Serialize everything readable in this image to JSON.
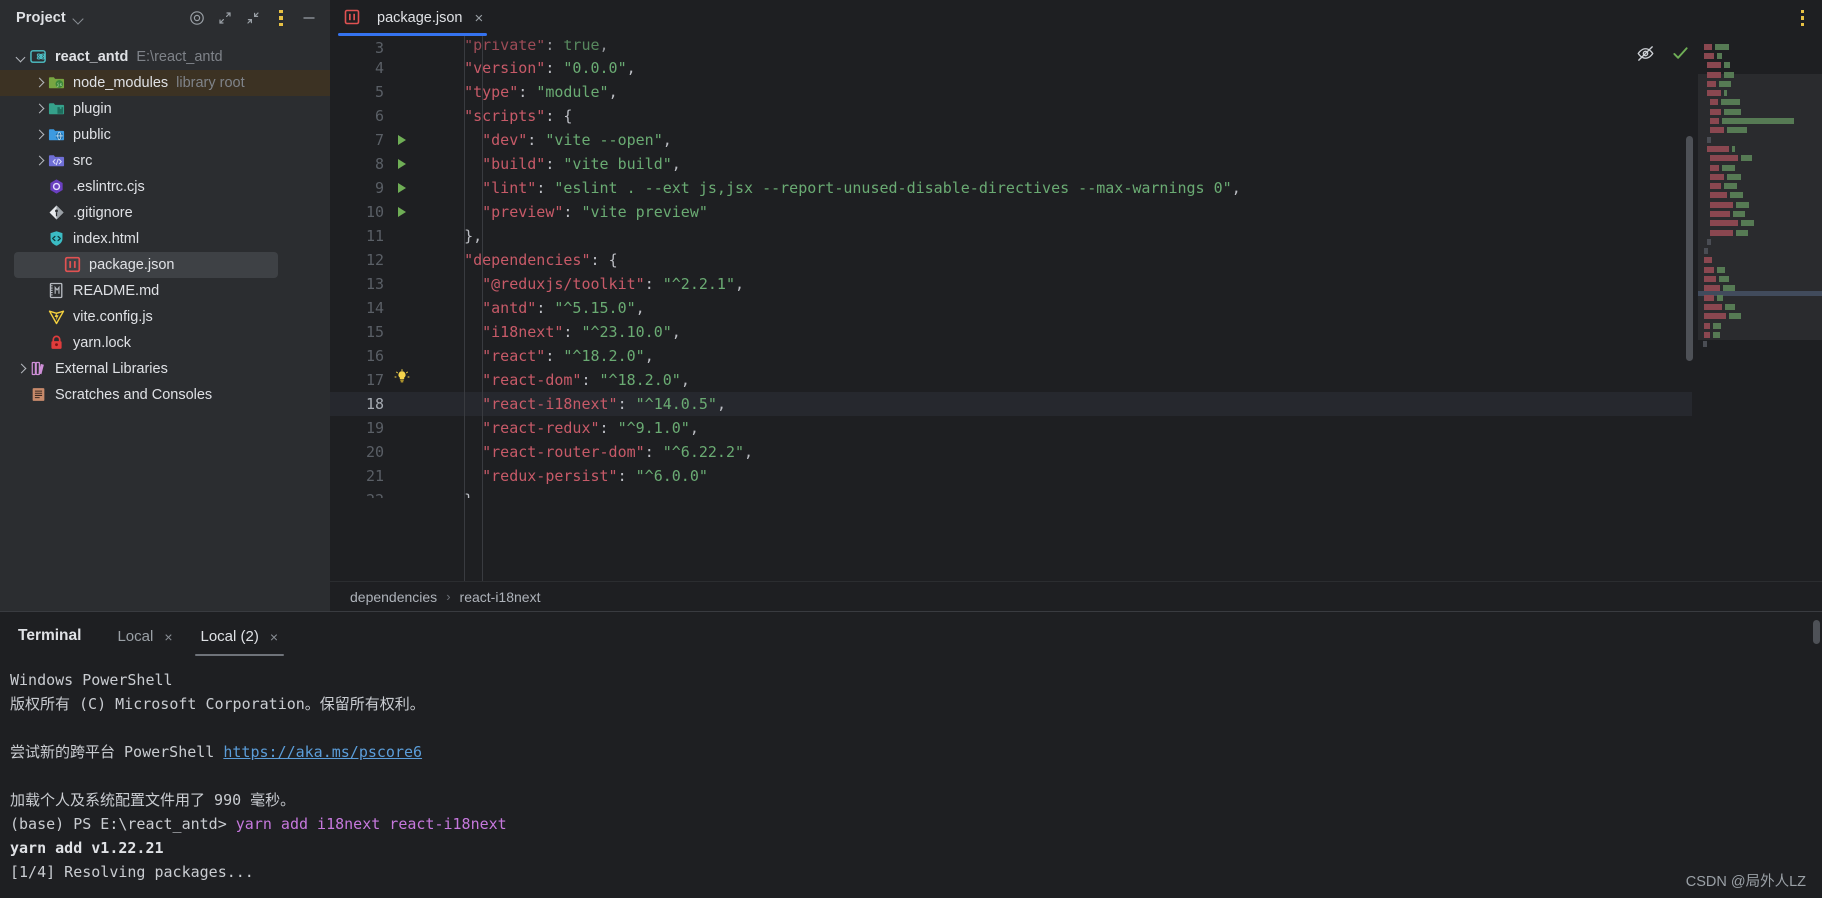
{
  "project": {
    "title": "Project",
    "header_icons": [
      "target-icon",
      "expand-icon",
      "collapse-icon",
      "more-vertical-icon",
      "minimize-icon"
    ],
    "tree": [
      {
        "name": "react_antd",
        "detail": "E:\\react_antd",
        "icon": "module-icon",
        "twisty": "open",
        "indent": 0,
        "state": "normal",
        "bold": true
      },
      {
        "name": "node_modules",
        "detail": "library root",
        "icon": "node-folder-icon",
        "twisty": "closed",
        "indent": 1,
        "state": "dir-selected",
        "bold": false
      },
      {
        "name": "plugin",
        "detail": "",
        "icon": "plugin-folder-icon",
        "twisty": "closed",
        "indent": 1,
        "state": "normal",
        "bold": false
      },
      {
        "name": "public",
        "detail": "",
        "icon": "public-folder-icon",
        "twisty": "closed",
        "indent": 1,
        "state": "normal",
        "bold": false
      },
      {
        "name": "src",
        "detail": "",
        "icon": "source-folder-icon",
        "twisty": "closed",
        "indent": 1,
        "state": "normal",
        "bold": false
      },
      {
        "name": ".eslintrc.cjs",
        "detail": "",
        "icon": "eslint-icon",
        "twisty": "none",
        "indent": 1,
        "state": "normal",
        "bold": false
      },
      {
        "name": ".gitignore",
        "detail": "",
        "icon": "git-icon",
        "twisty": "none",
        "indent": 1,
        "state": "normal",
        "bold": false
      },
      {
        "name": "index.html",
        "detail": "",
        "icon": "html-icon",
        "twisty": "none",
        "indent": 1,
        "state": "normal",
        "bold": false
      },
      {
        "name": "package.json",
        "detail": "",
        "icon": "npm-icon",
        "twisty": "none",
        "indent": 1,
        "state": "file-selected",
        "bold": false
      },
      {
        "name": "README.md",
        "detail": "",
        "icon": "markdown-icon",
        "twisty": "none",
        "indent": 1,
        "state": "normal",
        "bold": false
      },
      {
        "name": "vite.config.js",
        "detail": "",
        "icon": "vite-icon",
        "twisty": "none",
        "indent": 1,
        "state": "normal",
        "bold": false
      },
      {
        "name": "yarn.lock",
        "detail": "",
        "icon": "lock-icon",
        "twisty": "none",
        "indent": 1,
        "state": "normal",
        "bold": false
      },
      {
        "name": "External Libraries",
        "detail": "",
        "icon": "library-icon",
        "twisty": "closed",
        "indent": 0,
        "state": "normal",
        "bold": false
      },
      {
        "name": "Scratches and Consoles",
        "detail": "",
        "icon": "scratch-icon",
        "twisty": "none",
        "indent": 0,
        "state": "normal",
        "bold": false
      }
    ]
  },
  "editor": {
    "tab": {
      "label": "package.json",
      "icon": "npm-icon",
      "close": "×",
      "active": true
    },
    "menu_icon": "more-vertical-icon",
    "gutter_icons": {
      "inspection": "eye-crossed-icon",
      "status": "check-icon"
    },
    "first_visible_line": 3,
    "current_line": 18,
    "lines": [
      {
        "n": 3,
        "marker": "none",
        "indent": 1,
        "key": "\"private\"",
        "value": "true",
        "value_type": "literal",
        "comma": true,
        "clipped_top": true
      },
      {
        "n": 4,
        "marker": "none",
        "indent": 1,
        "key": "\"version\"",
        "value": "\"0.0.0\"",
        "value_type": "string",
        "comma": true
      },
      {
        "n": 5,
        "marker": "none",
        "indent": 1,
        "key": "\"type\"",
        "value": "\"module\"",
        "value_type": "string",
        "comma": true
      },
      {
        "n": 6,
        "marker": "none",
        "indent": 1,
        "key": "\"scripts\"",
        "value": "{",
        "value_type": "brace",
        "comma": false
      },
      {
        "n": 7,
        "marker": "run",
        "indent": 2,
        "key": "\"dev\"",
        "value": "\"vite --open\"",
        "value_type": "string",
        "comma": true
      },
      {
        "n": 8,
        "marker": "run",
        "indent": 2,
        "key": "\"build\"",
        "value": "\"vite build\"",
        "value_type": "string",
        "comma": true
      },
      {
        "n": 9,
        "marker": "run",
        "indent": 2,
        "key": "\"lint\"",
        "value": "\"eslint . --ext js,jsx --report-unused-disable-directives --max-warnings 0\"",
        "value_type": "string",
        "comma": true
      },
      {
        "n": 10,
        "marker": "run",
        "indent": 2,
        "key": "\"preview\"",
        "value": "\"vite preview\"",
        "value_type": "string",
        "comma": false
      },
      {
        "n": 11,
        "marker": "none",
        "indent": 1,
        "key": "",
        "value": "},",
        "value_type": "raw",
        "comma": false
      },
      {
        "n": 12,
        "marker": "none",
        "indent": 1,
        "key": "\"dependencies\"",
        "value": "{",
        "value_type": "brace",
        "comma": false
      },
      {
        "n": 13,
        "marker": "none",
        "indent": 2,
        "key": "\"@reduxjs/toolkit\"",
        "value": "\"^2.2.1\"",
        "value_type": "string",
        "comma": true
      },
      {
        "n": 14,
        "marker": "none",
        "indent": 2,
        "key": "\"antd\"",
        "value": "\"^5.15.0\"",
        "value_type": "string",
        "comma": true
      },
      {
        "n": 15,
        "marker": "none",
        "indent": 2,
        "key": "\"i18next\"",
        "value": "\"^23.10.0\"",
        "value_type": "string",
        "comma": true
      },
      {
        "n": 16,
        "marker": "none",
        "indent": 2,
        "key": "\"react\"",
        "value": "\"^18.2.0\"",
        "value_type": "string",
        "comma": true
      },
      {
        "n": 17,
        "marker": "bulb",
        "indent": 2,
        "key": "\"react-dom\"",
        "value": "\"^18.2.0\"",
        "value_type": "string",
        "comma": true
      },
      {
        "n": 18,
        "marker": "none",
        "indent": 2,
        "key": "\"react-i18next\"",
        "value": "\"^14.0.5\"",
        "value_type": "string",
        "comma": true
      },
      {
        "n": 19,
        "marker": "none",
        "indent": 2,
        "key": "\"react-redux\"",
        "value": "\"^9.1.0\"",
        "value_type": "string",
        "comma": true
      },
      {
        "n": 20,
        "marker": "none",
        "indent": 2,
        "key": "\"react-router-dom\"",
        "value": "\"^6.22.2\"",
        "value_type": "string",
        "comma": true
      },
      {
        "n": 21,
        "marker": "none",
        "indent": 2,
        "key": "\"redux-persist\"",
        "value": "\"^6.0.0\"",
        "value_type": "string",
        "comma": false
      },
      {
        "n": 22,
        "marker": "none",
        "indent": 1,
        "key": "",
        "value": "}",
        "value_type": "raw",
        "comma": false,
        "clipped_bottom": true
      }
    ],
    "breadcrumb": {
      "items": [
        "dependencies",
        "react-i18next"
      ],
      "separator": "›"
    }
  },
  "terminal": {
    "title": "Terminal",
    "tabs": [
      {
        "label": "Local",
        "close": "×",
        "active": false
      },
      {
        "label": "Local (2)",
        "close": "×",
        "active": true
      }
    ],
    "lines": [
      {
        "type": "plain",
        "text": "Windows PowerShell"
      },
      {
        "type": "plain",
        "text": "版权所有 (C) Microsoft Corporation。保留所有权利。"
      },
      {
        "type": "plain",
        "text": ""
      },
      {
        "type": "link-line",
        "prefix": "尝试新的跨平台 PowerShell ",
        "link": "https://aka.ms/pscore6"
      },
      {
        "type": "plain",
        "text": ""
      },
      {
        "type": "plain",
        "text": "加载个人及系统配置文件用了 990 毫秒。"
      },
      {
        "type": "prompt",
        "prompt": "(base) PS E:\\react_antd> ",
        "command": "yarn add i18next react-i18next"
      },
      {
        "type": "bold",
        "text": "yarn add v1.22.21"
      },
      {
        "type": "plain",
        "text": "[1/4] Resolving packages..."
      }
    ]
  },
  "watermark": "CSDN @局外人LZ",
  "colors": {
    "background": "#1e1f22",
    "panel": "#2b2d30",
    "accent_tab": "#3573f0",
    "key": "#c75a68",
    "string": "#6aab73",
    "link": "#5b9dd9",
    "command": "#c678dd",
    "selection_dir": "#3c3223",
    "selection_file": "#3e4145"
  },
  "chart_data": null
}
